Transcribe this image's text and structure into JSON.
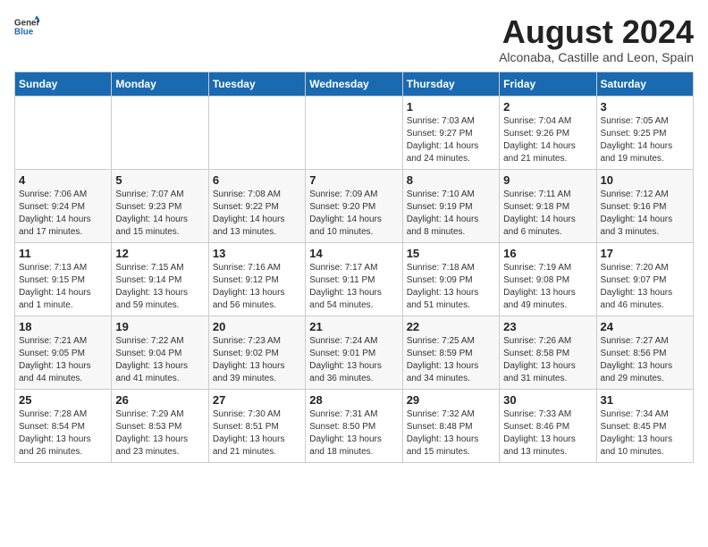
{
  "header": {
    "logo_general": "General",
    "logo_blue": "Blue",
    "month_year": "August 2024",
    "location": "Alconaba, Castille and Leon, Spain"
  },
  "weekdays": [
    "Sunday",
    "Monday",
    "Tuesday",
    "Wednesday",
    "Thursday",
    "Friday",
    "Saturday"
  ],
  "weeks": [
    [
      {
        "day": "",
        "info": ""
      },
      {
        "day": "",
        "info": ""
      },
      {
        "day": "",
        "info": ""
      },
      {
        "day": "",
        "info": ""
      },
      {
        "day": "1",
        "info": "Sunrise: 7:03 AM\nSunset: 9:27 PM\nDaylight: 14 hours\nand 24 minutes."
      },
      {
        "day": "2",
        "info": "Sunrise: 7:04 AM\nSunset: 9:26 PM\nDaylight: 14 hours\nand 21 minutes."
      },
      {
        "day": "3",
        "info": "Sunrise: 7:05 AM\nSunset: 9:25 PM\nDaylight: 14 hours\nand 19 minutes."
      }
    ],
    [
      {
        "day": "4",
        "info": "Sunrise: 7:06 AM\nSunset: 9:24 PM\nDaylight: 14 hours\nand 17 minutes."
      },
      {
        "day": "5",
        "info": "Sunrise: 7:07 AM\nSunset: 9:23 PM\nDaylight: 14 hours\nand 15 minutes."
      },
      {
        "day": "6",
        "info": "Sunrise: 7:08 AM\nSunset: 9:22 PM\nDaylight: 14 hours\nand 13 minutes."
      },
      {
        "day": "7",
        "info": "Sunrise: 7:09 AM\nSunset: 9:20 PM\nDaylight: 14 hours\nand 10 minutes."
      },
      {
        "day": "8",
        "info": "Sunrise: 7:10 AM\nSunset: 9:19 PM\nDaylight: 14 hours\nand 8 minutes."
      },
      {
        "day": "9",
        "info": "Sunrise: 7:11 AM\nSunset: 9:18 PM\nDaylight: 14 hours\nand 6 minutes."
      },
      {
        "day": "10",
        "info": "Sunrise: 7:12 AM\nSunset: 9:16 PM\nDaylight: 14 hours\nand 3 minutes."
      }
    ],
    [
      {
        "day": "11",
        "info": "Sunrise: 7:13 AM\nSunset: 9:15 PM\nDaylight: 14 hours\nand 1 minute."
      },
      {
        "day": "12",
        "info": "Sunrise: 7:15 AM\nSunset: 9:14 PM\nDaylight: 13 hours\nand 59 minutes."
      },
      {
        "day": "13",
        "info": "Sunrise: 7:16 AM\nSunset: 9:12 PM\nDaylight: 13 hours\nand 56 minutes."
      },
      {
        "day": "14",
        "info": "Sunrise: 7:17 AM\nSunset: 9:11 PM\nDaylight: 13 hours\nand 54 minutes."
      },
      {
        "day": "15",
        "info": "Sunrise: 7:18 AM\nSunset: 9:09 PM\nDaylight: 13 hours\nand 51 minutes."
      },
      {
        "day": "16",
        "info": "Sunrise: 7:19 AM\nSunset: 9:08 PM\nDaylight: 13 hours\nand 49 minutes."
      },
      {
        "day": "17",
        "info": "Sunrise: 7:20 AM\nSunset: 9:07 PM\nDaylight: 13 hours\nand 46 minutes."
      }
    ],
    [
      {
        "day": "18",
        "info": "Sunrise: 7:21 AM\nSunset: 9:05 PM\nDaylight: 13 hours\nand 44 minutes."
      },
      {
        "day": "19",
        "info": "Sunrise: 7:22 AM\nSunset: 9:04 PM\nDaylight: 13 hours\nand 41 minutes."
      },
      {
        "day": "20",
        "info": "Sunrise: 7:23 AM\nSunset: 9:02 PM\nDaylight: 13 hours\nand 39 minutes."
      },
      {
        "day": "21",
        "info": "Sunrise: 7:24 AM\nSunset: 9:01 PM\nDaylight: 13 hours\nand 36 minutes."
      },
      {
        "day": "22",
        "info": "Sunrise: 7:25 AM\nSunset: 8:59 PM\nDaylight: 13 hours\nand 34 minutes."
      },
      {
        "day": "23",
        "info": "Sunrise: 7:26 AM\nSunset: 8:58 PM\nDaylight: 13 hours\nand 31 minutes."
      },
      {
        "day": "24",
        "info": "Sunrise: 7:27 AM\nSunset: 8:56 PM\nDaylight: 13 hours\nand 29 minutes."
      }
    ],
    [
      {
        "day": "25",
        "info": "Sunrise: 7:28 AM\nSunset: 8:54 PM\nDaylight: 13 hours\nand 26 minutes."
      },
      {
        "day": "26",
        "info": "Sunrise: 7:29 AM\nSunset: 8:53 PM\nDaylight: 13 hours\nand 23 minutes."
      },
      {
        "day": "27",
        "info": "Sunrise: 7:30 AM\nSunset: 8:51 PM\nDaylight: 13 hours\nand 21 minutes."
      },
      {
        "day": "28",
        "info": "Sunrise: 7:31 AM\nSunset: 8:50 PM\nDaylight: 13 hours\nand 18 minutes."
      },
      {
        "day": "29",
        "info": "Sunrise: 7:32 AM\nSunset: 8:48 PM\nDaylight: 13 hours\nand 15 minutes."
      },
      {
        "day": "30",
        "info": "Sunrise: 7:33 AM\nSunset: 8:46 PM\nDaylight: 13 hours\nand 13 minutes."
      },
      {
        "day": "31",
        "info": "Sunrise: 7:34 AM\nSunset: 8:45 PM\nDaylight: 13 hours\nand 10 minutes."
      }
    ]
  ]
}
